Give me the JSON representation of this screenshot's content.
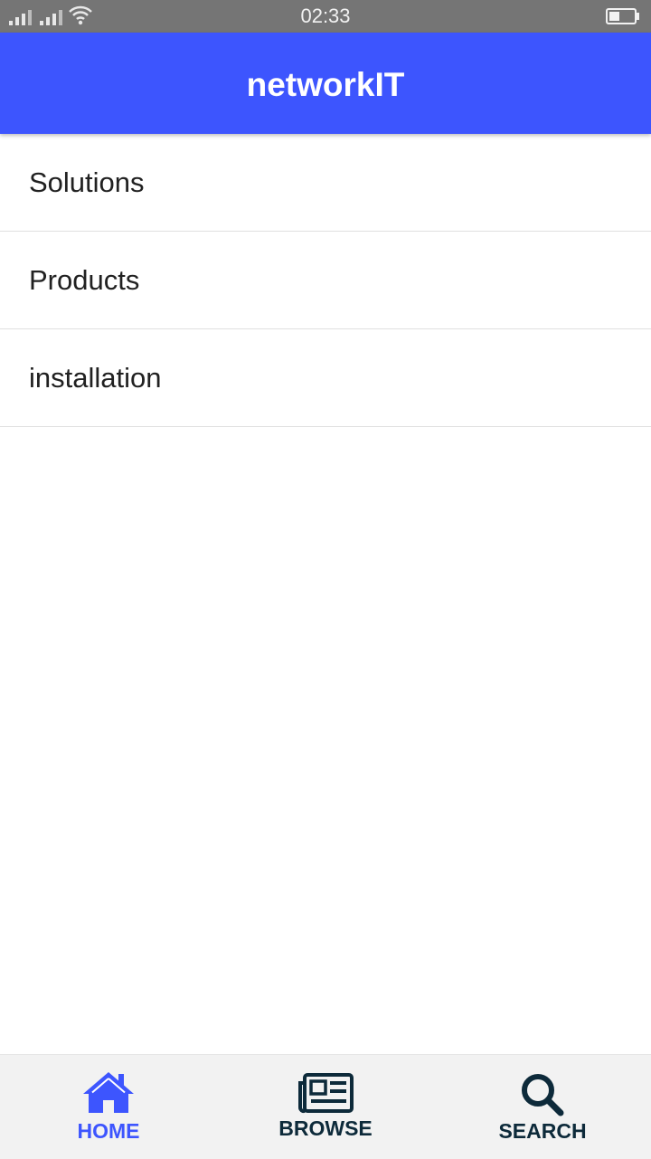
{
  "status_bar": {
    "time": "02:33",
    "icons": [
      "signal-icon",
      "signal-icon",
      "wifi-icon",
      "battery-icon"
    ]
  },
  "app_bar": {
    "title": "networkIT",
    "color": "#3d55fe"
  },
  "menu": {
    "items": [
      {
        "label": "Solutions"
      },
      {
        "label": "Products"
      },
      {
        "label": "installation"
      }
    ]
  },
  "bottom_nav": {
    "active_color": "#3d55fe",
    "inactive_color": "#0d2a3a",
    "items": [
      {
        "label": "HOME",
        "icon": "home-icon",
        "active": true
      },
      {
        "label": "BROWSE",
        "icon": "newspaper-icon",
        "active": false
      },
      {
        "label": "SEARCH",
        "icon": "search-icon",
        "active": false
      }
    ]
  }
}
